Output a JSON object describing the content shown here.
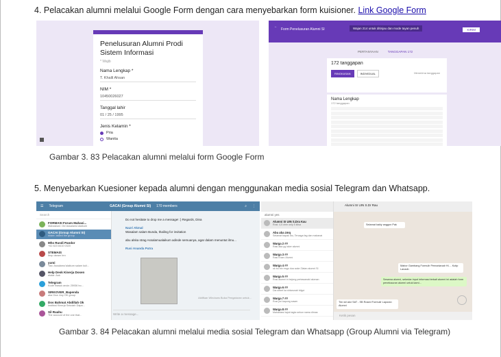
{
  "step4": {
    "text": "4.  Pelacakan alumni melalui Google Form dengan cara menyebarkan form kuisioner. ",
    "link": "Link Google Form"
  },
  "caption1": "Gambar 3. 83 Pelacakan alumni melalui form Google Form",
  "step5": "5.  Menyebarkan Kuesioner kepada alumni dengan menggunakan media sosial Telegram dan Whatsapp.",
  "caption2": "Gambar 3. 84 Pelacakan alumni melalui media sosial Telegram dan Whatsapp (Group Alumni via Telegram)",
  "form_left": {
    "title": "Penelusuran Alumni Prodi Sistem Informasi",
    "required": "* Wajib",
    "field1_label": "Nama Lengkap *",
    "field1_value": "T. Khalil Ahsan",
    "field2_label": "NIM *",
    "field2_value": "10450026027",
    "field3_label": "Tanggal lahir",
    "field3_value": "01 / 25 / 1995",
    "field4_label": "Jenis Kelamin *",
    "opt1": "Pria",
    "opt2": "Wanita"
  },
  "form_right": {
    "title": "Form Penelusuran Alumni SI",
    "notice": "Wajan 214 untuk ditinjau dan mode tayan penuh",
    "send": "KIRIM",
    "tab1": "PERTANYAAN",
    "tab2": "TANGGAPAN",
    "tab2_count": "172",
    "count": "172 tanggapan",
    "btn1": "RINGKASAN",
    "btn2": "INDIVIDUAL",
    "accepting": "Menerima tanggapan",
    "question": "Nama Lengkap",
    "question_sub": "172 tanggapan"
  },
  "telegram": {
    "app": "Telegram",
    "group": "GACAI (Group Alumni SI)",
    "members": "170 members",
    "search": "Search",
    "chats": [
      {
        "name": "FORMASI Forum Mahasi...",
        "msg": "Mahasiswi: Ok! Assalamu'alaikum",
        "color": "#7bb35a"
      },
      {
        "name": "GACAI (Group Alumni SI)",
        "msg": "share: asked the group",
        "color": "#2f5b80"
      },
      {
        "name": "Mhs Rusdi Pandor",
        "msg": "+62 823 8410 0320",
        "color": "#888"
      },
      {
        "name": "STEMAIS",
        "msg": "Ibop daram bro",
        "color": "#b94a4a"
      },
      {
        "name": "yumi",
        "msg": "Yaa: Assalamu'alaikum salam kuli...",
        "color": "#7a8a9a"
      },
      {
        "name": "Help Desk Kinerja Dosen",
        "msg": "ekdar: Aok",
        "color": "#556"
      },
      {
        "name": "Telegram",
        "msg": "Kode masuk anda: 25936 bo...",
        "color": "#2ba0da"
      },
      {
        "name": "SIRKOVER_Bapenda",
        "msg": "aka Ona: Any OK group",
        "color": "#c87b7b"
      },
      {
        "name": "Dos Bahmat Abdillah Ok",
        "msg": "Institusi Kinerja Sekolah Dapa...",
        "color": "#3a6"
      },
      {
        "name": "Sil Ruahu",
        "msg": "The account of the one that...",
        "color": "#a59"
      }
    ],
    "msg1_sender": "Nazri Akmal",
    "msg1": "Do not hesitate to drop me a message! :) Regards, Dina",
    "msg2_sender": "Nazri Akmal",
    "msg2": "Wasalam salam Bunda, thailing for invitation",
    "msg3": "abu alska strag  Assalamualaikum adinde semuanya, agar dalam menuntut ilmu...",
    "msg4_sender": "Rusi Ananda Putra",
    "input": "Write a message...",
    "watermark": "Aktifkan Windows\nBuka Pengaturan untuk..."
  },
  "whatsapp": {
    "search": "alumni yes",
    "header": "Alumni SI UIN S.Dr Rau",
    "chats": [
      {
        "name": "Alumni SI UIN S.Dra Kau",
        "msg": "Rosi: 4,5 ohm only 5 kilsa"
      },
      {
        "name": "Abu aba zmq",
        "msg": "Selamat bapak ibu, Tercaga fag dan mabanat"
      },
      {
        "name": "Warga 2 ##",
        "msg": "Rasi ada yg loker alumni"
      },
      {
        "name": "Warga 3 ##",
        "msg": "Rasi Khan: Alumni"
      },
      {
        "name": "Warga 4 ##",
        "msg": "ok bu bin rmgo dua aoke Zlatan alumni SI"
      },
      {
        "name": "Warga 5 ##",
        "msg": "Rosi alumni in bejong pertawanaki aluman"
      },
      {
        "name": "Warga 6 ##",
        "msg": "Dia sebet ka shtarunah bilgoi"
      },
      {
        "name": "Warga 7 ##",
        "msg": "Rosi juri kapong sawer"
      },
      {
        "name": "Warga 8 ##",
        "msg": "Mahasiswi tajuk tagta sekun nama dimas"
      }
    ],
    "bubble1": "Selamat kakiy anggon Pak",
    "bubble2": "Mabor Gambang Formulir Pemanlanalr Hi.... Kutip Lanadn",
    "bubble3": "Sesama alumni, sekedar input informasi terkait alumni ini adalah form penelusuran alumni untuk kami...",
    "bubble4": "Tim wil alor SAT - SB Rosed  Formulir Laporan Alumni",
    "input": "Ketik pesan"
  }
}
